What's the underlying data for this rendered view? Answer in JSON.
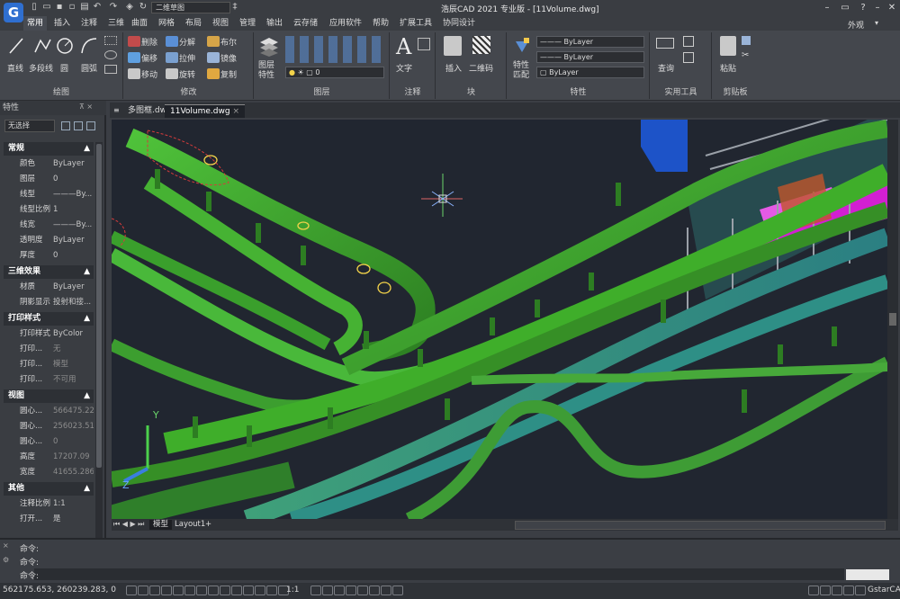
{
  "app": {
    "title": "浩辰CAD 2021 专业版 - [11Volume.dwg]",
    "logo": "G",
    "workspace": "二维草图",
    "view_menu": "外观"
  },
  "menu_tabs": [
    "常用",
    "插入",
    "注释",
    "三维",
    "曲面",
    "网格",
    "布局",
    "视图",
    "管理",
    "输出",
    "云存储",
    "应用软件",
    "帮助",
    "扩展工具",
    "协同设计"
  ],
  "ribbon": {
    "draw": {
      "title": "绘图",
      "items": [
        "直线",
        "多段线",
        "圆",
        "圆弧"
      ]
    },
    "modify": {
      "title": "修改",
      "items": [
        "删除",
        "分解",
        "布尔",
        "偏移",
        "拉伸",
        "镜像",
        "移动",
        "旋转",
        "复制"
      ]
    },
    "layer": {
      "title": "图层",
      "items": [
        "图层特性"
      ],
      "current_layer": "0"
    },
    "annotation": {
      "title": "注释",
      "items": [
        "文字"
      ]
    },
    "block": {
      "title": "块",
      "items": [
        "插入",
        "二维码"
      ]
    },
    "properties": {
      "title": "特性",
      "items": [
        "特性匹配"
      ],
      "color": "ByLayer",
      "linetype": "ByLayer",
      "lineweight": "ByLayer"
    },
    "utilities": {
      "title": "实用工具",
      "items": [
        "查询"
      ]
    },
    "clipboard": {
      "title": "剪贴板",
      "items": [
        "粘贴"
      ]
    }
  },
  "doc_tabs": [
    "多图框.dwg",
    "11Volume.dwg"
  ],
  "properties_panel": {
    "title": "特性",
    "selection": "无选择",
    "sections": [
      {
        "name": "常规",
        "rows": [
          [
            "颜色",
            "ByLayer"
          ],
          [
            "图层",
            "0"
          ],
          [
            "线型",
            "———By..."
          ],
          [
            "线型比例",
            "1"
          ],
          [
            "线宽",
            "———By..."
          ],
          [
            "透明度",
            "ByLayer"
          ],
          [
            "厚度",
            "0"
          ]
        ]
      },
      {
        "name": "三维效果",
        "rows": [
          [
            "材质",
            "ByLayer"
          ],
          [
            "阴影显示",
            "投射和接..."
          ]
        ]
      },
      {
        "name": "打印样式",
        "rows": [
          [
            "打印样式",
            "ByColor"
          ],
          [
            "打印...",
            "无"
          ],
          [
            "打印...",
            "模型"
          ],
          [
            "打印...",
            "不可用"
          ]
        ]
      },
      {
        "name": "视图",
        "rows": [
          [
            "圆心...",
            "566475.223"
          ],
          [
            "圆心...",
            "256023.518"
          ],
          [
            "圆心...",
            "0"
          ],
          [
            "高度",
            "17207.09"
          ],
          [
            "宽度",
            "41655.286"
          ]
        ]
      },
      {
        "name": "其他",
        "rows": [
          [
            "注释比例",
            "1:1"
          ],
          [
            "打开...",
            "是"
          ]
        ]
      }
    ]
  },
  "layout_tabs": [
    "模型",
    "Layout1",
    "+"
  ],
  "command_lines": [
    "命令:",
    "命令:",
    "命令:"
  ],
  "status": {
    "coords": "562175.653, 260239.283, 0",
    "scale": "1:1",
    "brand": "GstarCAD"
  },
  "colors": {
    "accent": "#2f6fd0",
    "pipe_green": "#3fae2a",
    "pipe_teal": "#2e8f86",
    "canvas": "#212630",
    "magenta": "#d21fd2"
  },
  "axis": {
    "y": "Y",
    "z": "Z"
  }
}
